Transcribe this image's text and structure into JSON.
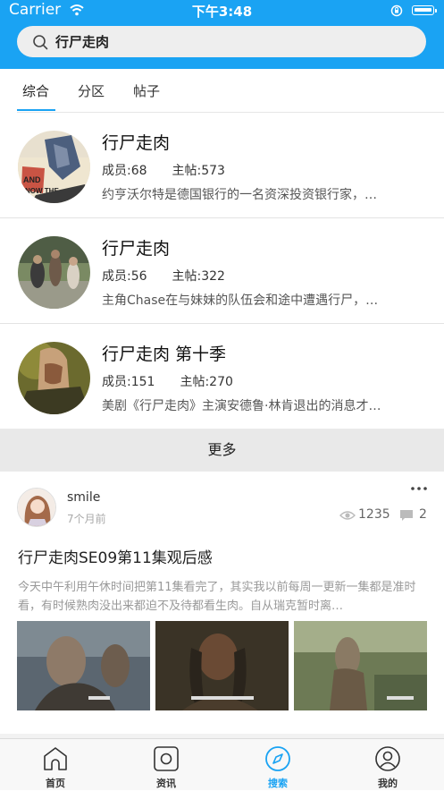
{
  "status_bar": {
    "carrier": "Carrier",
    "time": "下午3:48"
  },
  "search": {
    "query": "行尸走肉"
  },
  "tabs": [
    {
      "label": "综合",
      "active": true
    },
    {
      "label": "分区",
      "active": false
    },
    {
      "label": "帖子",
      "active": false
    }
  ],
  "groups": [
    {
      "name": "行尸走肉",
      "members": "成员:68",
      "posts": "主帖:573",
      "desc": "约亨沃尔特是德国银行的一名资深投资银行家，…"
    },
    {
      "name": "行尸走肉",
      "members": "成员:56",
      "posts": "主帖:322",
      "desc": "主角Chase在与妹妹的队伍会和途中遭遇行尸，…"
    },
    {
      "name": "行尸走肉 第十季",
      "members": "成员:151",
      "posts": "主帖:270",
      "desc": "美剧《行尸走肉》主演安德鲁·林肯退出的消息才…"
    }
  ],
  "more_label": "更多",
  "post": {
    "username": "smile",
    "time": "7个月前",
    "views": "1235",
    "comments": "2",
    "title": "行尸走肉SE09第11集观后感",
    "body": "今天中午利用午休时间把第11集看完了，其实我以前每周一更新一集都是准时看，有时候熟肉没出来都迫不及待都看生肉。自从瑞克暂时离…"
  },
  "nav": [
    {
      "label": "首页",
      "icon": "home-icon",
      "active": false
    },
    {
      "label": "资讯",
      "icon": "news-icon",
      "active": false
    },
    {
      "label": "搜索",
      "icon": "compass-icon",
      "active": true
    },
    {
      "label": "我的",
      "icon": "profile-icon",
      "active": false
    }
  ],
  "colors": {
    "accent": "#1aa3f3",
    "divider": "#e9e9e9"
  }
}
